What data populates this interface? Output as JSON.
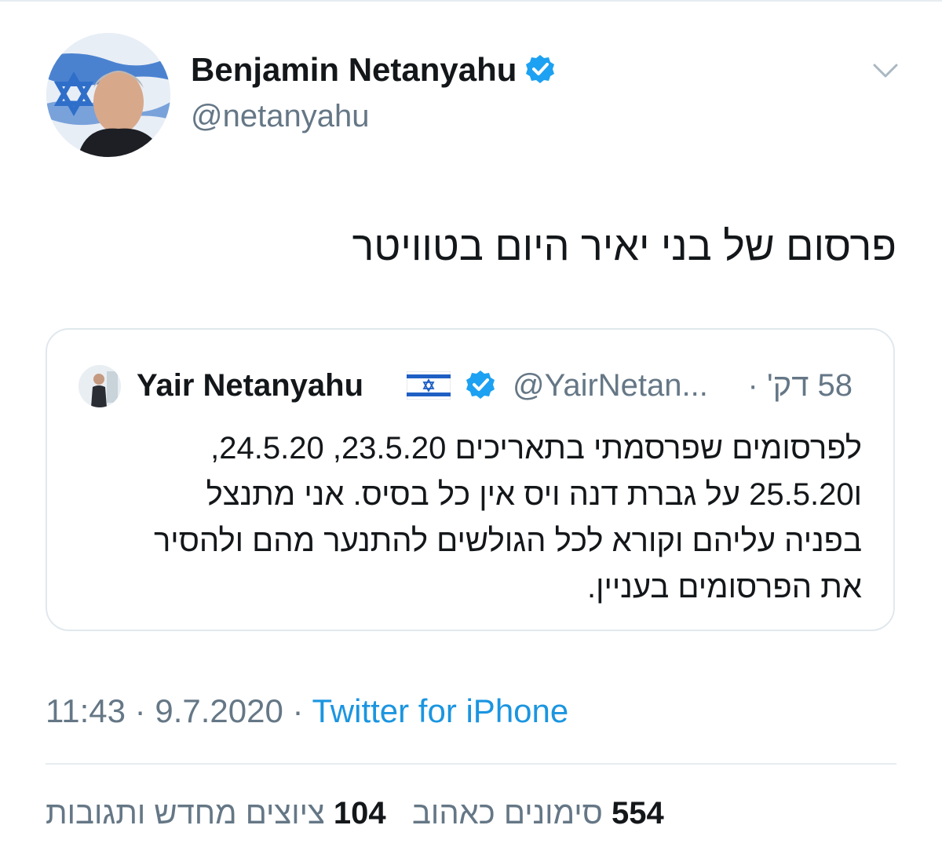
{
  "tweet": {
    "author_name": "Benjamin Netanyahu",
    "author_handle": "@netanyahu",
    "text": "פרסום של בני יאיר היום בטוויטר",
    "timestamp_time": "11:43",
    "timestamp_date": "9.7.2020",
    "separator": "·",
    "source": "Twitter for iPhone",
    "icons": [
      "avatar",
      "verified-badge-icon",
      "chevron-down-icon"
    ]
  },
  "quote": {
    "author_name": "Yair Netanyahu",
    "flag": "🇮🇱",
    "author_handle": "@YairNetan...",
    "separator": "·",
    "time": "58 דק'",
    "lines": [
      "לפרסומים שפרסמתי בתאריכים 23.5.20, 24.5.20,",
      "ו25.5.20 על גברת דנה ויס אין כל בסיס. אני מתנצל",
      "בפניה עליהם וקורא לכל הגולשים להתנער מהם ולהסיר",
      "את הפרסומים בעניין."
    ]
  },
  "stats": {
    "retweets_label": "ציוצים מחדש ותגובות",
    "retweets_count": "104",
    "likes_label": "סימונים כאהוב",
    "likes_count": "554"
  },
  "colors": {
    "verified_blue": "#1da1f2",
    "link_blue": "#1b95e0",
    "secondary_text": "#657786",
    "border": "#e1e8ed"
  }
}
